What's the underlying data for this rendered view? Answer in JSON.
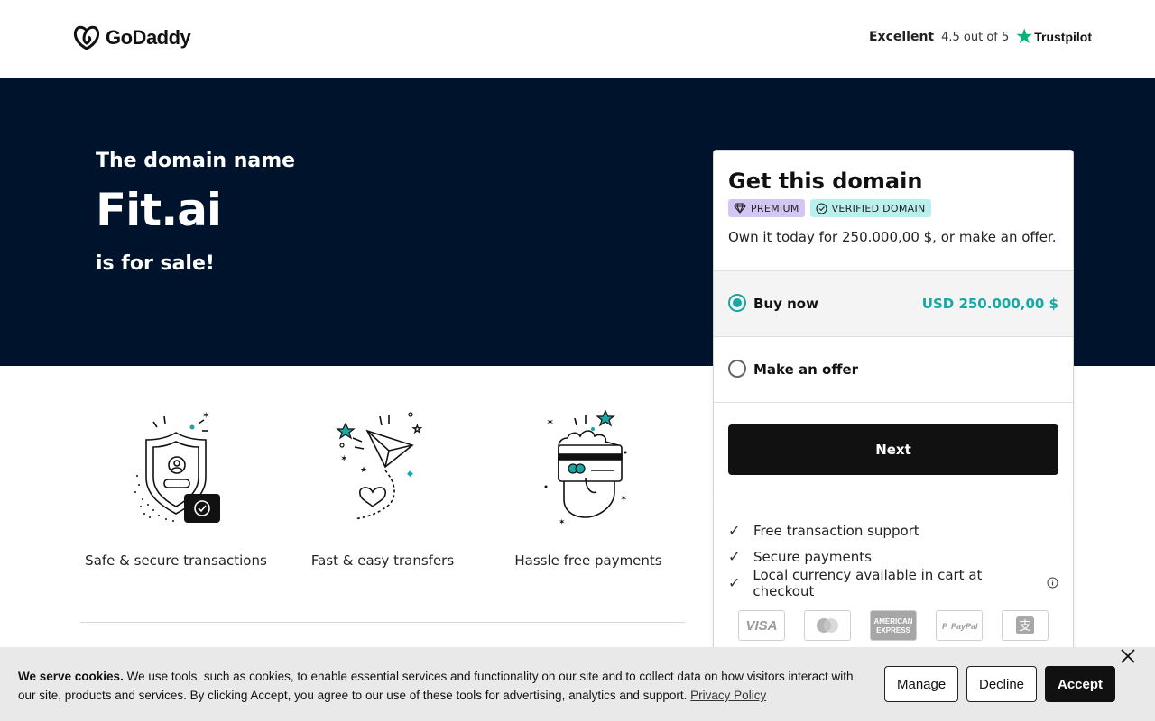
{
  "header": {
    "logo_text": "GoDaddy",
    "trust_label": "Excellent",
    "trust_rating": "4.5 out of 5",
    "trust_brand": "Trustpilot"
  },
  "hero": {
    "pre": "The domain name",
    "domain": "Fit.ai",
    "post": "is for sale!"
  },
  "features": [
    {
      "label": "Safe & secure transactions",
      "icon": "shield-icon"
    },
    {
      "label": "Fast & easy transfers",
      "icon": "paper-plane-icon"
    },
    {
      "label": "Hassle free payments",
      "icon": "card-payment-icon"
    }
  ],
  "card": {
    "title": "Get this domain",
    "badge_premium": "PREMIUM",
    "badge_verified": "VERIFIED DOMAIN",
    "description": "Own it today for 250.000,00 $, or make an offer.",
    "option_buy_label": "Buy now",
    "option_buy_price": "USD 250.000,00 $",
    "option_offer_label": "Make an offer",
    "next_label": "Next",
    "benefits": [
      "Free transaction support",
      "Secure payments",
      "Local currency available in cart at checkout"
    ],
    "payments": [
      "VISA",
      "Mastercard",
      "American Express",
      "PayPal",
      "Alipay"
    ]
  },
  "cookie": {
    "lead": "We serve cookies.",
    "body": "We use tools, such as cookies, to enable essential services and functionality on our site and to collect data on how visitors interact with our site, products and services. By clicking Accept, you agree to our use of these tools for advertising, analytics and support.",
    "link": "Privacy Policy",
    "manage": "Manage",
    "decline": "Decline",
    "accept": "Accept"
  },
  "colors": {
    "hero_bg": "#00132d",
    "accent_teal": "#1ba6a6",
    "button_dark": "#111111",
    "trustpilot_green": "#00b67a"
  }
}
